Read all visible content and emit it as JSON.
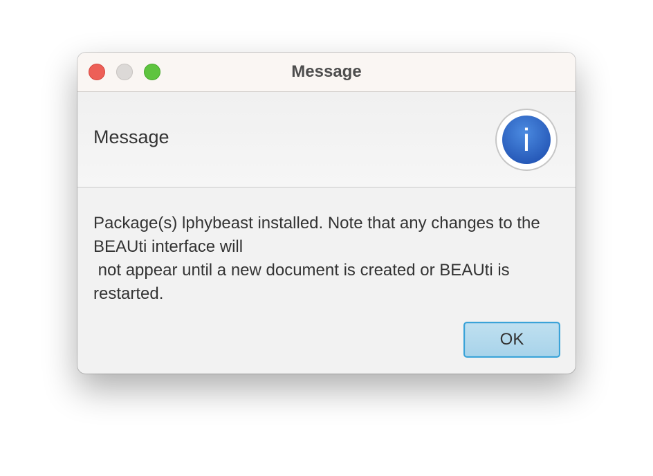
{
  "window": {
    "title": "Message",
    "buttons": {
      "close": "close-icon",
      "minimize": "minimize-icon",
      "zoom": "zoom-icon"
    }
  },
  "header": {
    "text": "Message",
    "icon": "info-icon",
    "icon_glyph": "i"
  },
  "content": {
    "message_lines": [
      "Package(s) lphybeast installed. Note that any changes to the",
      "BEAUti interface will",
      " not appear until a new document is created or BEAUti is",
      "restarted."
    ]
  },
  "actions": {
    "ok_label": "OK"
  },
  "colors": {
    "close": "#ed5f57",
    "minimize": "#dcd9d7",
    "zoom": "#5ec43f",
    "info_icon": "#2f6ccb",
    "button_focus": "#3aa3d8"
  }
}
